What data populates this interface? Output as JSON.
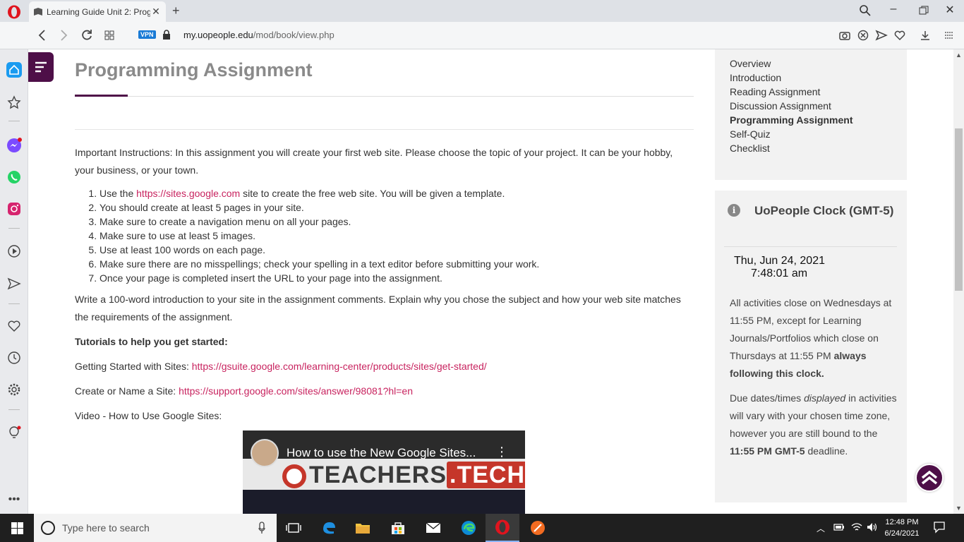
{
  "browser": {
    "tab_title": "Learning Guide Unit 2: Prog",
    "vpn_label": "VPN",
    "url_domain": "my.uopeople.edu",
    "url_path": "/mod/book/view.php"
  },
  "page": {
    "title": "Programming Assignment",
    "intro": "Important Instructions: In this assignment you will create your first web site. Please choose the topic of your project. It can be your hobby, your business, or your town.",
    "steps": [
      {
        "before": "Use the ",
        "link": "https://sites.google.com",
        "after": " site to create the free web site. You will be given a template."
      },
      {
        "before": "You should create at least 5 pages in your site.",
        "link": "",
        "after": ""
      },
      {
        "before": "Make sure to create a navigation menu on all your pages.",
        "link": "",
        "after": ""
      },
      {
        "before": "Make sure to use at least 5 images.",
        "link": "",
        "after": ""
      },
      {
        "before": "Use at least 100 words on each page.",
        "link": "",
        "after": ""
      },
      {
        "before": "Make sure there are no misspellings; check your spelling in a text editor before submitting your work.",
        "link": "",
        "after": ""
      },
      {
        "before": "Once your page is completed insert the URL to your page into the assignment.",
        "link": "",
        "after": ""
      }
    ],
    "write_intro": "Write a 100-word introduction to your site in the assignment comments. Explain why you chose the subject and how your web site matches the requirements of the assignment.",
    "tutorials_heading": "Tutorials to help you get started:",
    "getting_started_label": "Getting Started with Sites: ",
    "getting_started_link": "https://gsuite.google.com/learning-center/products/sites/get-started/",
    "create_label": "Create or Name a Site: ",
    "create_link": "https://support.google.com/sites/answer/98081?hl=en",
    "video_label": "Video - How to Use Google Sites:",
    "video_title": "How to use the New Google Sites...",
    "video_brand_a": "TEACHERS",
    "video_brand_b": ".TECH"
  },
  "toc": {
    "items": [
      "Overview",
      "Introduction",
      "Reading Assignment",
      "Discussion Assignment",
      "Programming Assignment",
      "Self-Quiz",
      "Checklist"
    ],
    "active_index": 4
  },
  "clock": {
    "heading": "UoPeople Clock (GMT-5)",
    "date": "Thu, Jun 24, 2021",
    "time": "7:48:01 am",
    "p1_a": "All activities close on Wednesdays at 11:55 PM, except for Learning Journals/Portfolios which close on Thursdays at 11:55 PM ",
    "p1_b": "always following this clock.",
    "p2_a": "Due dates/times ",
    "p2_em": "displayed",
    "p2_b": " in activities will vary with your chosen time zone, however you are still bound to the ",
    "p2_bold": "11:55 PM GMT-5",
    "p2_c": " deadline."
  },
  "taskbar": {
    "search_placeholder": "Type here to search",
    "time": "12:48 PM",
    "date": "6/24/2021"
  },
  "colors": {
    "brand": "#4e0f48",
    "link": "#c8235f",
    "opera_red": "#e0141e"
  }
}
